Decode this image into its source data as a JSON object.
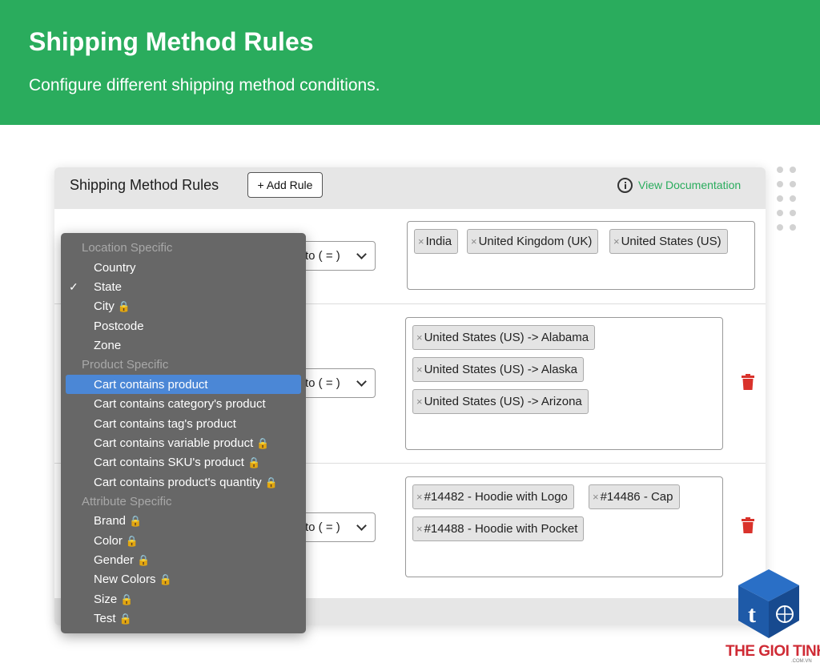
{
  "hero": {
    "title": "Shipping Method Rules",
    "subtitle": "Configure different shipping method conditions."
  },
  "card": {
    "title": "Shipping Method Rules",
    "add_rule_label": "+ Add Rule",
    "doc_link_label": "View Documentation"
  },
  "rules": [
    {
      "operator": "to ( = )",
      "tags": [
        "India",
        "United Kingdom (UK)",
        "United States (US)"
      ]
    },
    {
      "operator": "to ( = )",
      "tags": [
        "United States (US) -> Alabama",
        "United States (US) -> Alaska",
        "United States (US) -> Arizona"
      ]
    },
    {
      "operator": "to ( = )",
      "tags": [
        "#14482 - Hoodie with Logo",
        "#14486 - Cap",
        "#14488 - Hoodie with Pocket"
      ]
    }
  ],
  "dropdown": {
    "groups": [
      "Location Specific",
      "Product Specific",
      "Attribute Specific"
    ],
    "items": [
      {
        "label": "Country",
        "locked": false,
        "checked": false
      },
      {
        "label": "State",
        "locked": false,
        "checked": true
      },
      {
        "label": "City",
        "locked": true,
        "checked": false
      },
      {
        "label": "Postcode",
        "locked": false,
        "checked": false
      },
      {
        "label": "Zone",
        "locked": false,
        "checked": false
      },
      {
        "label": "Cart contains product",
        "locked": false,
        "checked": false,
        "highlighted": true
      },
      {
        "label": "Cart contains category's product",
        "locked": false,
        "checked": false
      },
      {
        "label": "Cart contains tag's product",
        "locked": false,
        "checked": false
      },
      {
        "label": "Cart contains variable product",
        "locked": true,
        "checked": false
      },
      {
        "label": "Cart contains SKU's product",
        "locked": true,
        "checked": false
      },
      {
        "label": "Cart contains product's quantity",
        "locked": true,
        "checked": false
      },
      {
        "label": "Brand",
        "locked": true,
        "checked": false
      },
      {
        "label": "Color",
        "locked": true,
        "checked": false
      },
      {
        "label": "Gender",
        "locked": true,
        "checked": false
      },
      {
        "label": "New Colors",
        "locked": true,
        "checked": false
      },
      {
        "label": "Size",
        "locked": true,
        "checked": false
      },
      {
        "label": "Test",
        "locked": true,
        "checked": false
      }
    ],
    "check_glyph": "✓",
    "lock_glyph": "🔒"
  },
  "tag_remove_glyph": "×",
  "watermark": {
    "brand": "THE GIOI TINHOC",
    "domain": ".COM.VN"
  },
  "colors": {
    "brand_green": "#2aac5d",
    "delete_red": "#d9322b",
    "highlight_blue": "#4b87d6"
  }
}
